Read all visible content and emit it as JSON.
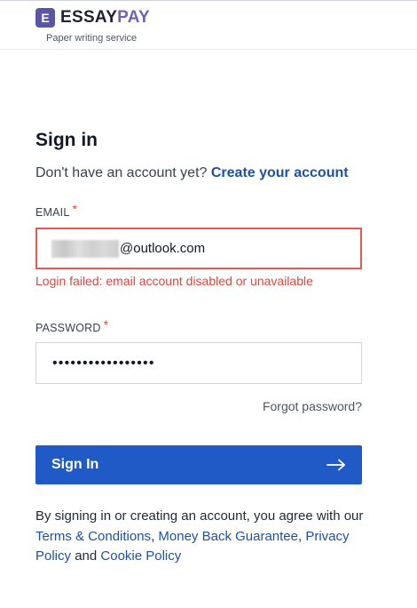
{
  "header": {
    "logo_letter": "E",
    "logo_word_1": "ESSAY",
    "logo_word_2": "PAY",
    "tagline": "Paper writing service"
  },
  "form": {
    "title": "Sign in",
    "subtitle_text": "Don't have an account yet?",
    "create_account_link": "Create your account",
    "email_label": "EMAIL",
    "required_mark": "*",
    "email_value": "@outlook.com",
    "email_error": "Login failed: email account disabled or unavailable",
    "password_label": "PASSWORD",
    "password_value": "•••••••••••••••••",
    "forgot_password": "Forgot password?",
    "signin_button": "Sign In"
  },
  "terms": {
    "text_1": "By signing in or creating an account, you agree with our",
    "link_terms": "Terms & Conditions",
    "sep_1": ",",
    "link_money_back": "Money Back Guarantee",
    "sep_2": ",",
    "link_privacy": "Privacy Policy",
    "and": "and",
    "link_cookie": "Cookie Policy"
  },
  "colors": {
    "primary": "#1f5ac7",
    "link": "#1e50a8",
    "error": "#e0453e",
    "brand": "#5b55a6"
  }
}
